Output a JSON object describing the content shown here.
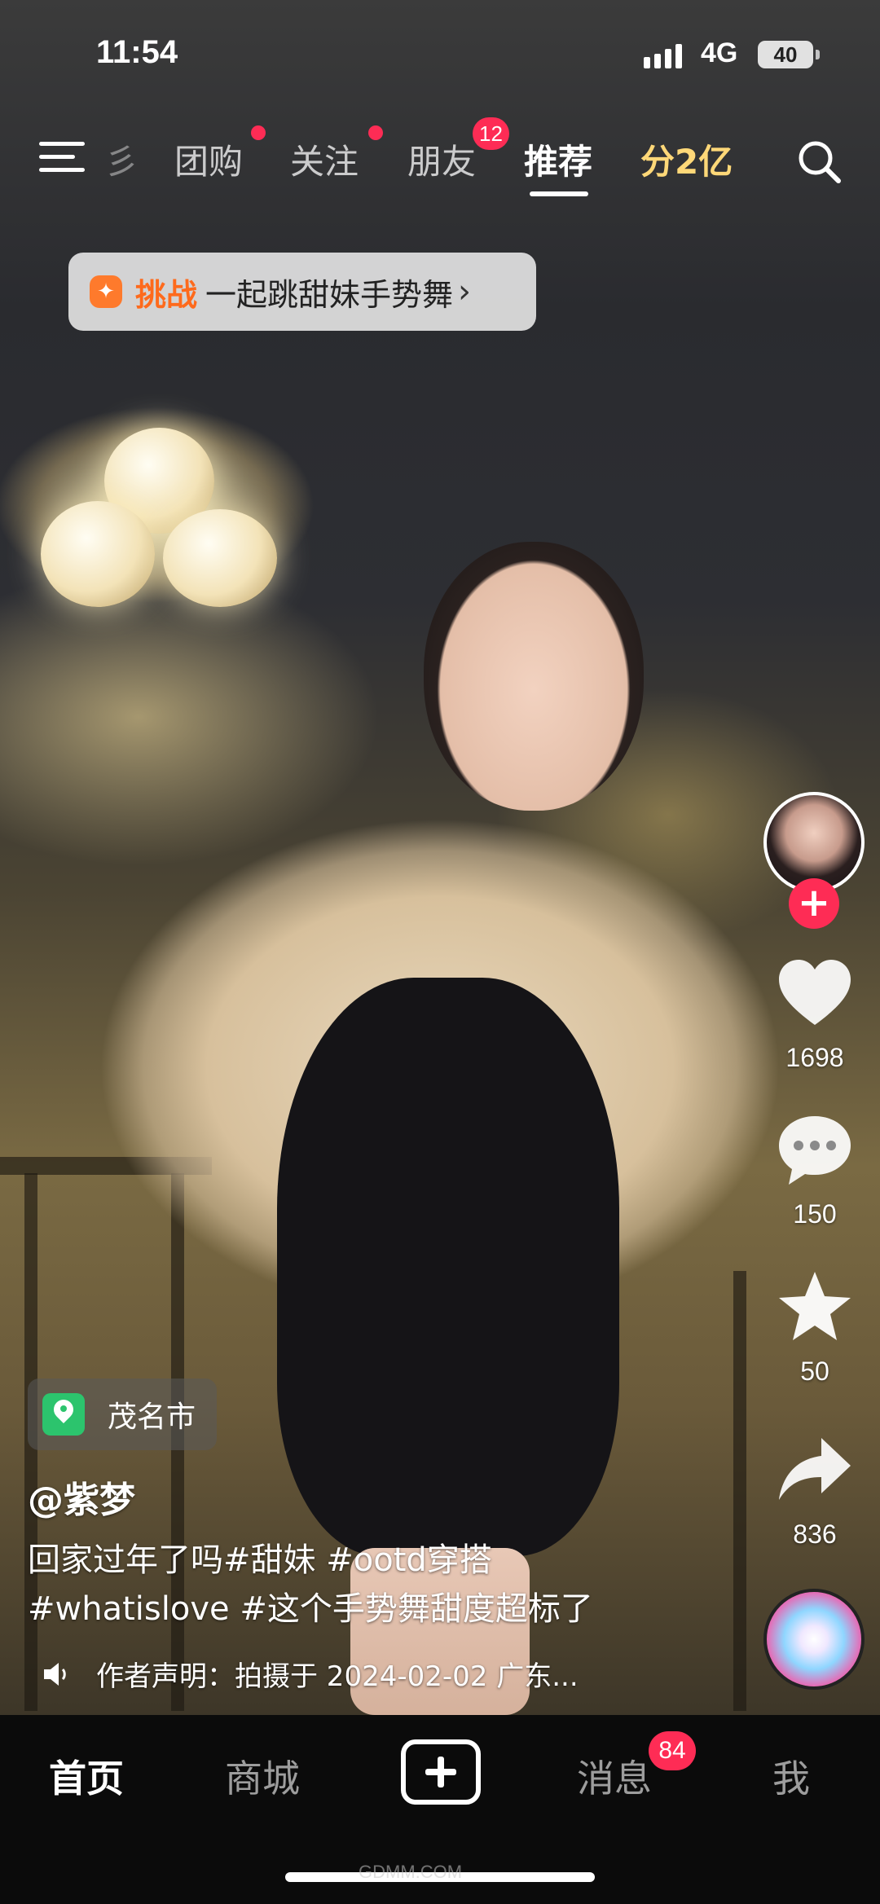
{
  "status_bar": {
    "time": "11:54",
    "network": "4G",
    "battery": "40"
  },
  "topnav": {
    "tabs": [
      {
        "label": "彡"
      },
      {
        "label": "团购"
      },
      {
        "label": "关注"
      },
      {
        "label": "朋友",
        "badge": "12"
      },
      {
        "label": "推荐"
      },
      {
        "label": "分2亿"
      }
    ]
  },
  "challenge": {
    "label": "挑战",
    "text": "一起跳甜妹手势舞",
    "chevron": "›"
  },
  "right_rail": {
    "like_count": "1698",
    "comment_count": "150",
    "favorite_count": "50",
    "share_count": "836",
    "follow_symbol": "+"
  },
  "video_info": {
    "location": "茂名市",
    "author": "@紫梦",
    "caption_line1": "回家过年了吗#甜妹 #ootd穿搭",
    "caption_line2": "#whatislove #这个手势舞甜度超标了",
    "declaration": "作者声明：拍摄于 2024-02-02 广东..."
  },
  "tabbar": {
    "home": "首页",
    "mall": "商城",
    "messages": "消息",
    "messages_badge": "84",
    "me": "我"
  },
  "watermark": "GDMM.COM"
}
